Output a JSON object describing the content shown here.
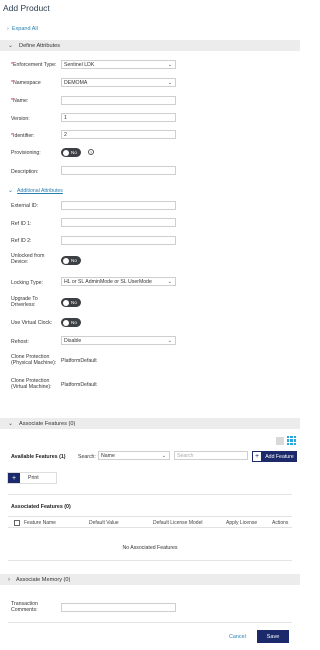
{
  "header": {
    "title": "Add Product"
  },
  "expand_all": "Expand All",
  "sections": {
    "define": "Define Attributes",
    "features": "Associate Features (0)",
    "memory": "Associate Memory (0)"
  },
  "fields": {
    "enforcement_type": {
      "label": "Enforcement Type:",
      "value": "Sentinel LDK"
    },
    "namespace": {
      "label": "Namespace",
      "value": "DEMOMA"
    },
    "name": {
      "label": "Name:",
      "value": ""
    },
    "version": {
      "label": "Version:",
      "value": "1"
    },
    "identifier": {
      "label": "Identifier:",
      "value": "2"
    },
    "provisioning": {
      "label": "Provisioning:",
      "toggle": "No"
    },
    "description": {
      "label": "Description:",
      "value": ""
    }
  },
  "additional": {
    "link": "Additional Attributes",
    "external_id": {
      "label": "External ID:",
      "value": ""
    },
    "ref_id_1": {
      "label": "Ref ID 1:",
      "value": ""
    },
    "ref_id_2": {
      "label": "Ref ID 2:",
      "value": ""
    },
    "unlocked": {
      "label1": "Unlocked from",
      "label2": "Device:",
      "toggle": "No"
    },
    "locking_type": {
      "label": "Locking Type:",
      "value": "HL or SL AdminMode or SL UserMode"
    },
    "upgrade": {
      "label1": "Upgrade To",
      "label2": "Driverless:",
      "toggle": "No"
    },
    "virtual_clock": {
      "label": "Use Virtual Clock:",
      "toggle": "No"
    },
    "rehost": {
      "label": "Rehost:",
      "value": "Disable"
    },
    "clone_physical": {
      "label1": "Clone Protection",
      "label2": "(Physical Machine):",
      "value": "PlatformDefault"
    },
    "clone_virtual": {
      "label1": "Clone Protection",
      "label2": "(Virtual Machine):",
      "value": "PlatformDefault"
    }
  },
  "features": {
    "available": "Available Features (1)",
    "search_label": "Search:",
    "search_by": "Name",
    "search_placeholder": "Search",
    "add_button": "Add Feature",
    "print": "Print",
    "associated": "Associated Features (0)",
    "columns": [
      "Feature Name",
      "Default Value",
      "Default License Model",
      "Apply License",
      "Actions"
    ],
    "empty": "No Associated Features"
  },
  "transaction": {
    "label1": "Transaction",
    "label2": "Comments:",
    "value": ""
  },
  "footer": {
    "cancel": "Cancel",
    "save": "Save"
  },
  "colors": {
    "accent": "#1c2a6b",
    "link": "#2a7fb0",
    "required": "#d0021b",
    "toggle_off": "#3c3f44",
    "grid_icon": "#29a8e0"
  }
}
